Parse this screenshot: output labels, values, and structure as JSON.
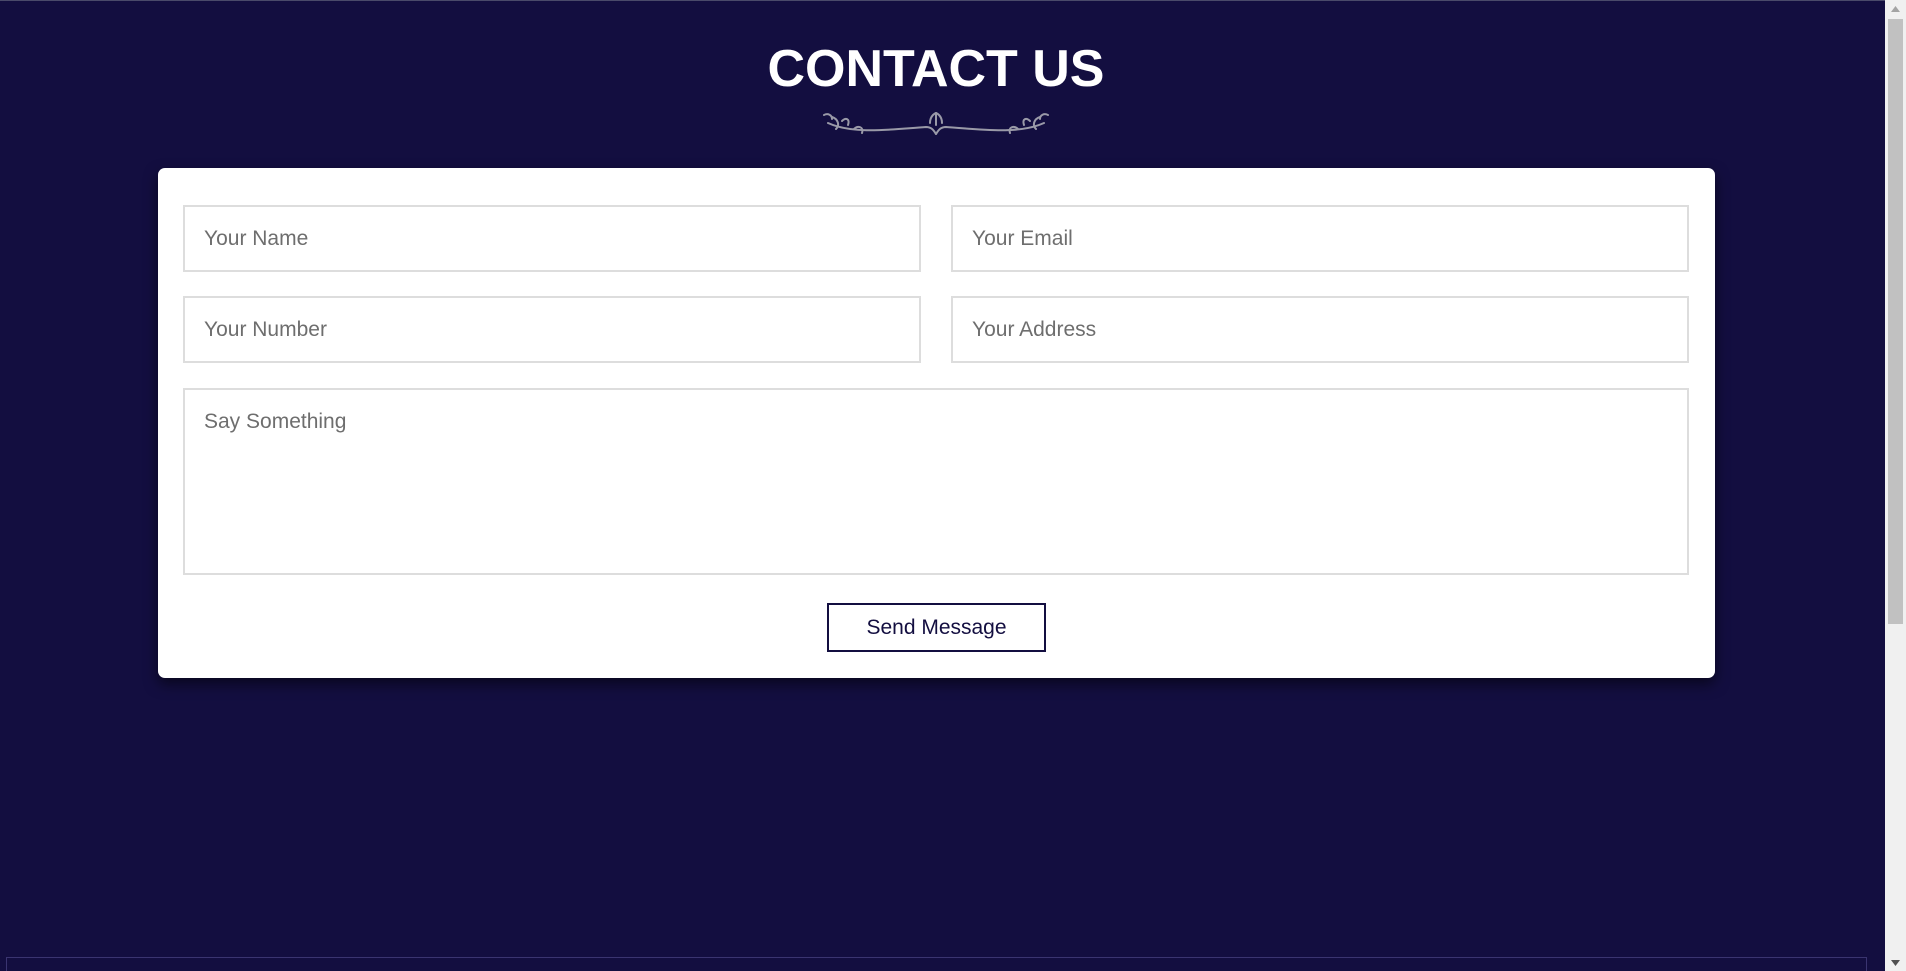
{
  "header": {
    "title": "CONTACT US",
    "ornament_icon": "floral-divider-icon"
  },
  "form": {
    "name_placeholder": "Your Name",
    "email_placeholder": "Your Email",
    "number_placeholder": "Your Number",
    "address_placeholder": "Your Address",
    "message_placeholder": "Say Something",
    "submit_label": "Send Message"
  },
  "colors": {
    "background": "#130e40",
    "card": "#ffffff",
    "button_border": "#130e40",
    "field_border": "#dddddd"
  }
}
